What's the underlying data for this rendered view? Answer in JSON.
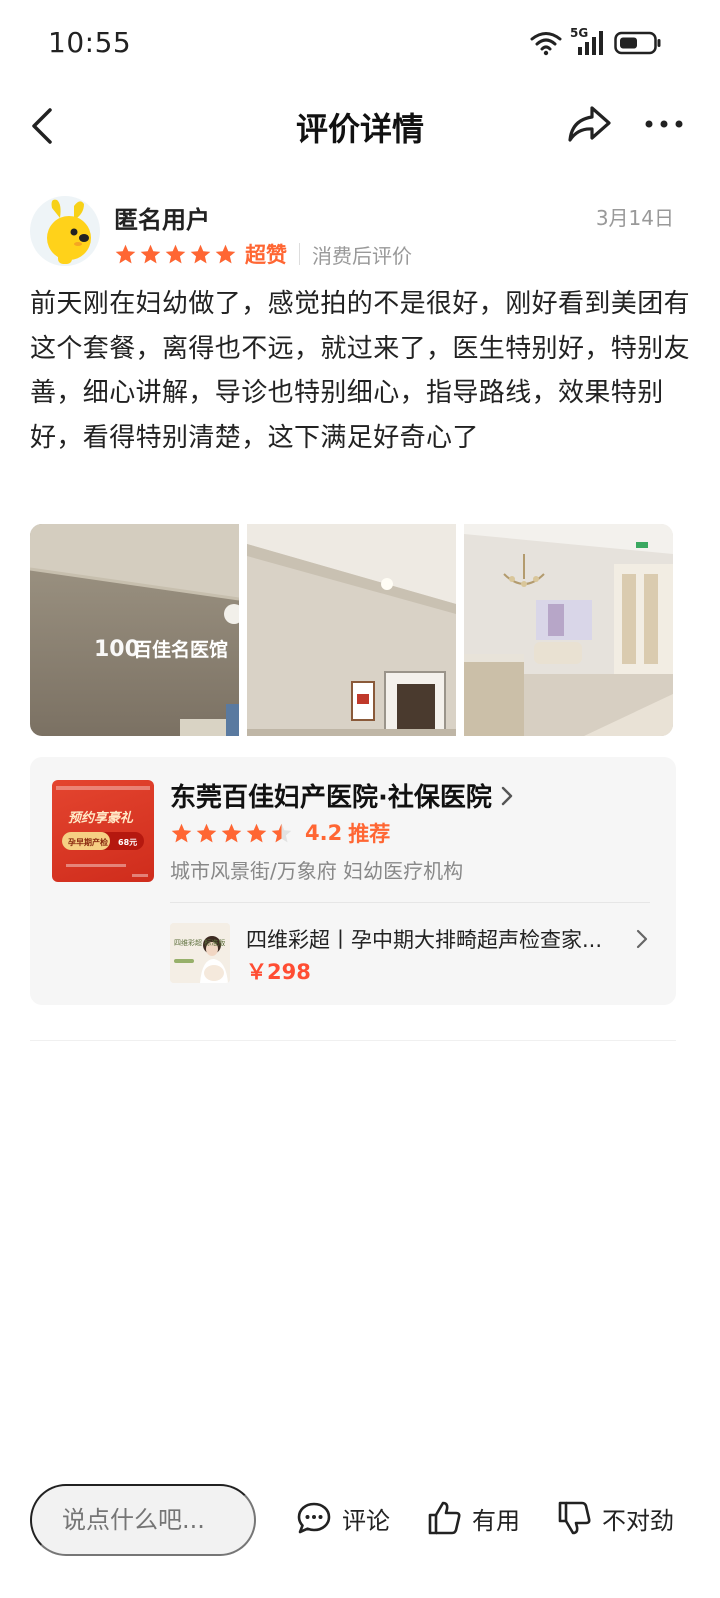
{
  "status_bar": {
    "time": "10:55",
    "network": "5G",
    "icons": [
      "wifi-icon",
      "signal-icon",
      "battery-icon"
    ]
  },
  "nav": {
    "title": "评价详情",
    "icons": [
      "back-icon",
      "share-icon",
      "more-icon"
    ]
  },
  "review": {
    "username": "匿名用户",
    "date": "3月14日",
    "stars": 5,
    "rating_label": "超赞",
    "source": "消费后评价",
    "text": "前天刚在妇幼做了，感觉拍的不是很好，刚好看到美团有这个套餐，离得也不远，就过来了，医生特别好，特别友善，细心讲解，导诊也特别细心，指导路线，效果特别好，看得特别清楚，这下满足好奇心了",
    "photos": [
      {
        "sign_text": "百佳名医馆",
        "logo_text": "100"
      },
      {},
      {}
    ]
  },
  "shop": {
    "name": "东莞百佳妇产医院·社保医院",
    "stars": 4.5,
    "score": "4.2",
    "recommend": "推荐",
    "meta": "城市风景街/万象府 妇幼医疗机构",
    "thumb": {
      "banner": "预约享豪礼",
      "item": "孕早期产检",
      "price": "68元"
    },
    "deal": {
      "title": "四维彩超丨孕中期大排畸超声检查家...",
      "price": "￥298",
      "thumb_text": "四维彩超 标准版"
    }
  },
  "bottom": {
    "input_placeholder": "说点什么吧...",
    "comment_label": "评论",
    "useful_label": "有用",
    "wrong_label": "不对劲"
  },
  "colors": {
    "accent": "#ff6633",
    "price": "#ff4d33",
    "text_primary": "#222222",
    "text_secondary": "#999999",
    "card_bg": "#f6f6f6"
  }
}
